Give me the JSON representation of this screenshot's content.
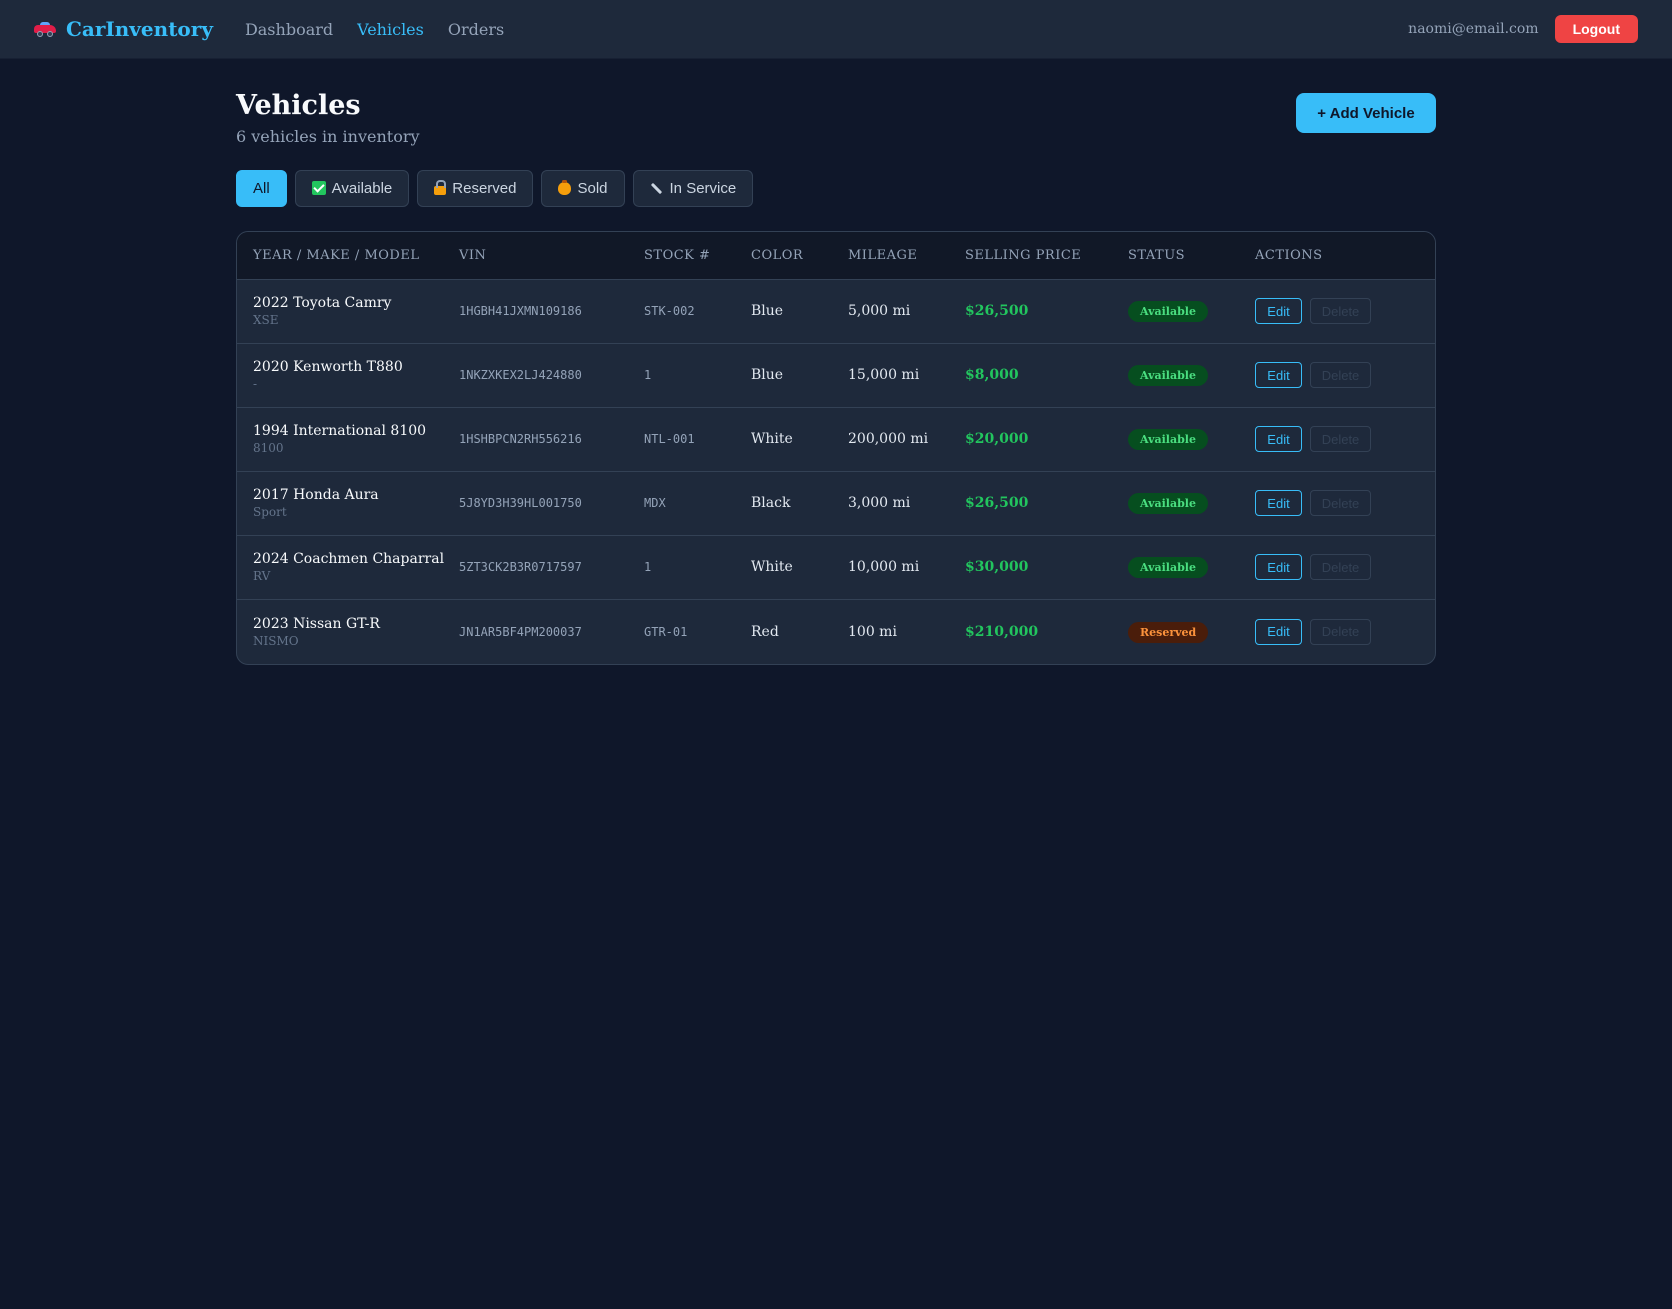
{
  "nav": {
    "brand": "CarInventory",
    "links": [
      {
        "label": "Dashboard",
        "active": false
      },
      {
        "label": "Vehicles",
        "active": true
      },
      {
        "label": "Orders",
        "active": false
      }
    ],
    "user_email": "naomi@email.com",
    "logout_label": "Logout"
  },
  "page": {
    "title": "Vehicles",
    "subtitle": "6 vehicles in inventory",
    "add_button": "+ Add Vehicle"
  },
  "filters": [
    {
      "label": "All",
      "icon": "",
      "active": true
    },
    {
      "label": "Available",
      "icon": "check-icon",
      "active": false
    },
    {
      "label": "Reserved",
      "icon": "lock-icon",
      "active": false
    },
    {
      "label": "Sold",
      "icon": "money-bag-icon",
      "active": false
    },
    {
      "label": "In Service",
      "icon": "wrench-icon",
      "active": false
    }
  ],
  "table": {
    "columns": [
      "Year / Make / Model",
      "VIN",
      "Stock #",
      "Color",
      "Mileage",
      "Selling Price",
      "Status",
      "Actions"
    ],
    "edit_label": "Edit",
    "delete_label": "Delete",
    "rows": [
      {
        "name": "2022 Toyota Camry",
        "trim": "XSE",
        "vin": "1HGBH41JXMN109186",
        "stock": "STK-002",
        "color": "Blue",
        "mileage": "5,000 mi",
        "price": "$26,500",
        "status": "Available",
        "status_kind": "available"
      },
      {
        "name": "2020 Kenworth T880",
        "trim": "-",
        "vin": "1NKZXKEX2LJ424880",
        "stock": "1",
        "color": "Blue",
        "mileage": "15,000 mi",
        "price": "$8,000",
        "status": "Available",
        "status_kind": "available"
      },
      {
        "name": "1994 International 8100",
        "trim": "8100",
        "vin": "1HSHBPCN2RH556216",
        "stock": "NTL-001",
        "color": "White",
        "mileage": "200,000 mi",
        "price": "$20,000",
        "status": "Available",
        "status_kind": "available"
      },
      {
        "name": "2017 Honda Aura",
        "trim": "Sport",
        "vin": "5J8YD3H39HL001750",
        "stock": "MDX",
        "color": "Black",
        "mileage": "3,000 mi",
        "price": "$26,500",
        "status": "Available",
        "status_kind": "available"
      },
      {
        "name": "2024 Coachmen Chaparral",
        "trim": "RV",
        "vin": "5ZT3CK2B3R0717597",
        "stock": "1",
        "color": "White",
        "mileage": "10,000 mi",
        "price": "$30,000",
        "status": "Available",
        "status_kind": "available"
      },
      {
        "name": "2023 Nissan GT-R",
        "trim": "NISMO",
        "vin": "JN1AR5BF4PM200037",
        "stock": "GTR-01",
        "color": "Red",
        "mileage": "100 mi",
        "price": "$210,000",
        "status": "Reserved",
        "status_kind": "reserved"
      }
    ]
  },
  "colors": {
    "background": "#0f172a",
    "accent": "#38bdf8",
    "available": "#22c55e",
    "reserved": "#fb923c",
    "danger": "#ef4444"
  }
}
